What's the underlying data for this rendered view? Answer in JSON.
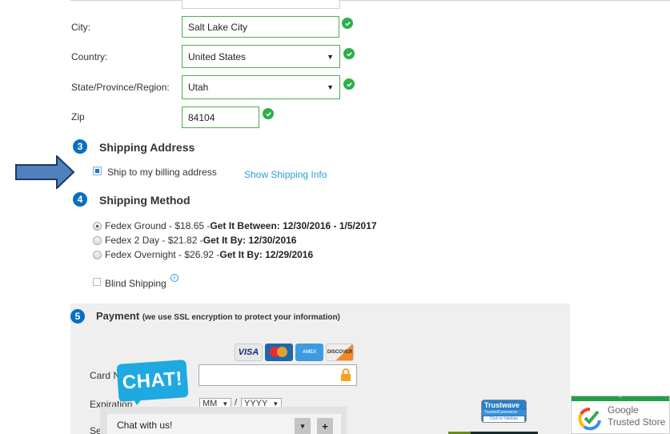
{
  "billing": {
    "city": {
      "label": "City:",
      "value": "Salt Lake City"
    },
    "country": {
      "label": "Country:",
      "value": "United States"
    },
    "state": {
      "label": "State/Province/Region:",
      "value": "Utah"
    },
    "zip": {
      "label": "Zip",
      "value": "84104"
    }
  },
  "shipping_address": {
    "step": "3",
    "title": "Shipping Address",
    "checkbox_label": "Ship to my billing address",
    "checked": true,
    "link": "Show Shipping Info"
  },
  "shipping_method": {
    "step": "4",
    "title": "Shipping Method",
    "options": [
      {
        "name": "Fedex Ground - $18.65 - ",
        "delivery": "Get It Between: 12/30/2016 - 1/5/2017",
        "selected": true
      },
      {
        "name": "Fedex 2 Day - $21.82 - ",
        "delivery": "Get It By: 12/30/2016",
        "selected": false
      },
      {
        "name": "Fedex Overnight - $26.92 - ",
        "delivery": "Get It By: 12/29/2016",
        "selected": false
      }
    ],
    "blind_shipping_label": "Blind Shipping",
    "info_icon": "i"
  },
  "payment": {
    "step": "5",
    "title": "Payment",
    "subtitle": "(we use SSL encryption to protect your information)",
    "cards": [
      "VISA",
      "MasterCard",
      "AMERICAN EXPRESS",
      "DISCOVER"
    ],
    "card_number_label": "Card N",
    "expiration_label": "Expiration",
    "exp_month": "MM",
    "exp_year": "YYYY",
    "exp_sep": "/",
    "security_label": "Se"
  },
  "chat": {
    "bubble": "CHAT!",
    "panel_text": "Chat with us!",
    "minimize": "▾",
    "expand": "+"
  },
  "badges": {
    "trustwave_title": "Trustwave",
    "trustwave_sub": "TrustedCommerce",
    "trustwave_cta": "Click to Validate",
    "google_line1": "Google",
    "google_line2": "Trusted Store",
    "google_toggle": "^"
  },
  "colors": {
    "valid_green": "#2bb04a",
    "step_blue": "#0b6fbf",
    "link_blue": "#2a9fd8",
    "chat_blue": "#1ea9e1",
    "arrow_fill": "#4f81bd"
  }
}
